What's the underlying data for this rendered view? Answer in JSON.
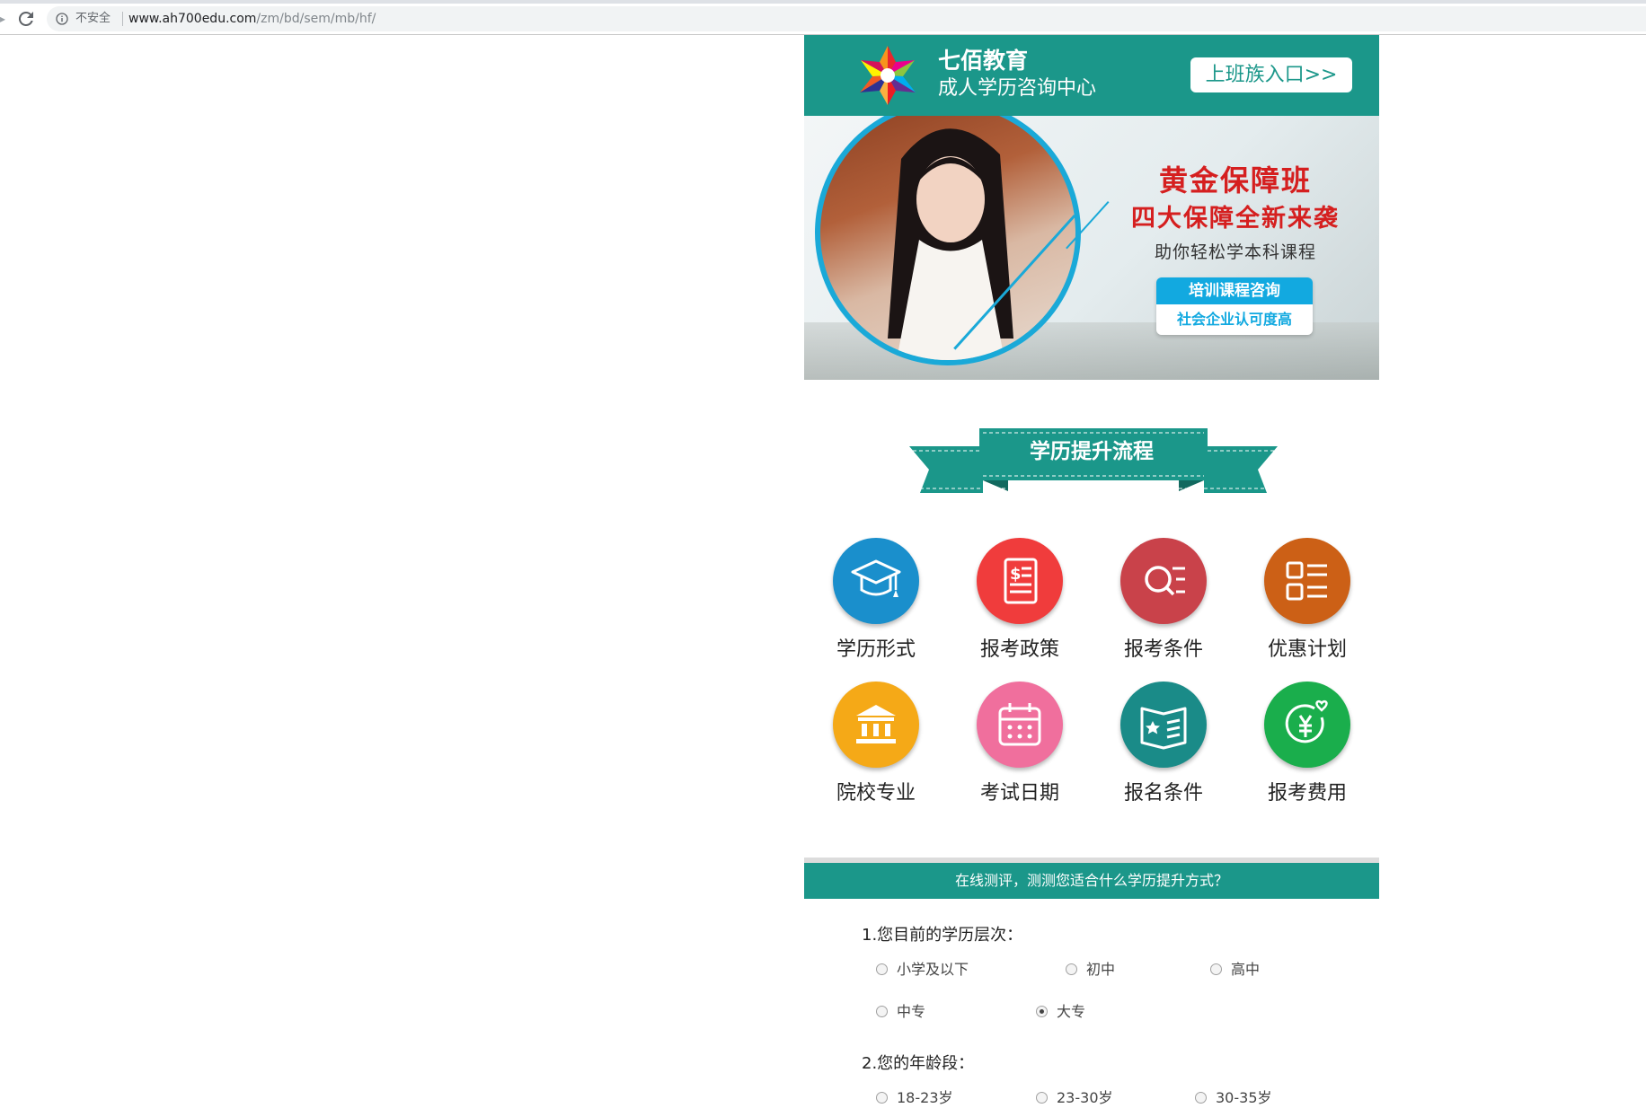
{
  "browser": {
    "security_label": "不安全",
    "url_host": "www.ah700edu.com",
    "url_path": "/zm/bd/sem/mb/hf/"
  },
  "header": {
    "brand_name": "七佰教育",
    "brand_subtitle": "成人学历咨询中心",
    "entry_button": "上班族入口>>"
  },
  "banner": {
    "title": "黄金保障班",
    "headline": "四大保障全新来袭",
    "subtitle": "助你轻松学本科课程",
    "tag_top": "培训课程咨询",
    "tag_bottom": "社会企业认可度高"
  },
  "section_title": "学历提升流程",
  "menu_items": [
    {
      "label": "学历形式",
      "icon": "graduation-cap-icon",
      "color": "#1a8fcc"
    },
    {
      "label": "报考政策",
      "icon": "policy-document-icon",
      "color": "#f03c3c"
    },
    {
      "label": "报考条件",
      "icon": "search-list-icon",
      "color": "#c9424a"
    },
    {
      "label": "优惠计划",
      "icon": "grid-list-icon",
      "color": "#cc6016"
    },
    {
      "label": "院校专业",
      "icon": "institution-icon",
      "color": "#f5a917"
    },
    {
      "label": "考试日期",
      "icon": "calendar-icon",
      "color": "#f06f9d"
    },
    {
      "label": "报名条件",
      "icon": "star-book-icon",
      "color": "#1a8b88"
    },
    {
      "label": "报考费用",
      "icon": "yen-heart-icon",
      "color": "#1aae4c"
    }
  ],
  "quiz": {
    "bar_text": "在线测评，测测您适合什么学历提升方式？",
    "q1": {
      "label": "1.您目前的学历层次：",
      "options": [
        "小学及以下",
        "初中",
        "高中",
        "中专",
        "大专"
      ],
      "selected": "大专"
    },
    "q2": {
      "label": "2.您的年龄段：",
      "options": [
        "18-23岁",
        "23-30岁",
        "30-35岁"
      ]
    }
  }
}
